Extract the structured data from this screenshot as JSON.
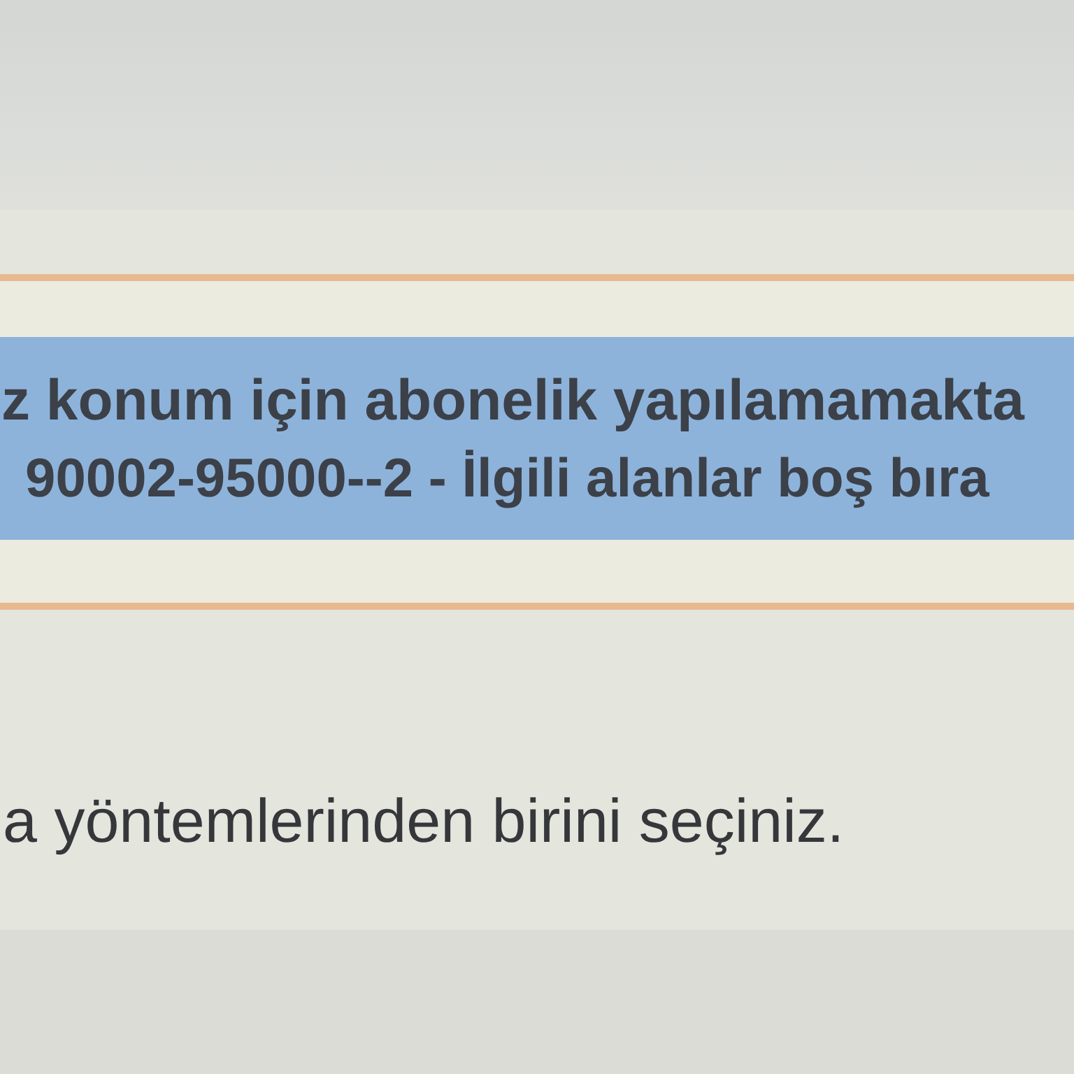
{
  "alert": {
    "lines": [
      "z konum için abonelik yapılamamakta",
      "90002-95000--2 - İlgili alanlar boş bıra"
    ]
  },
  "instruction": "a yöntemlerinden birini seçiniz."
}
